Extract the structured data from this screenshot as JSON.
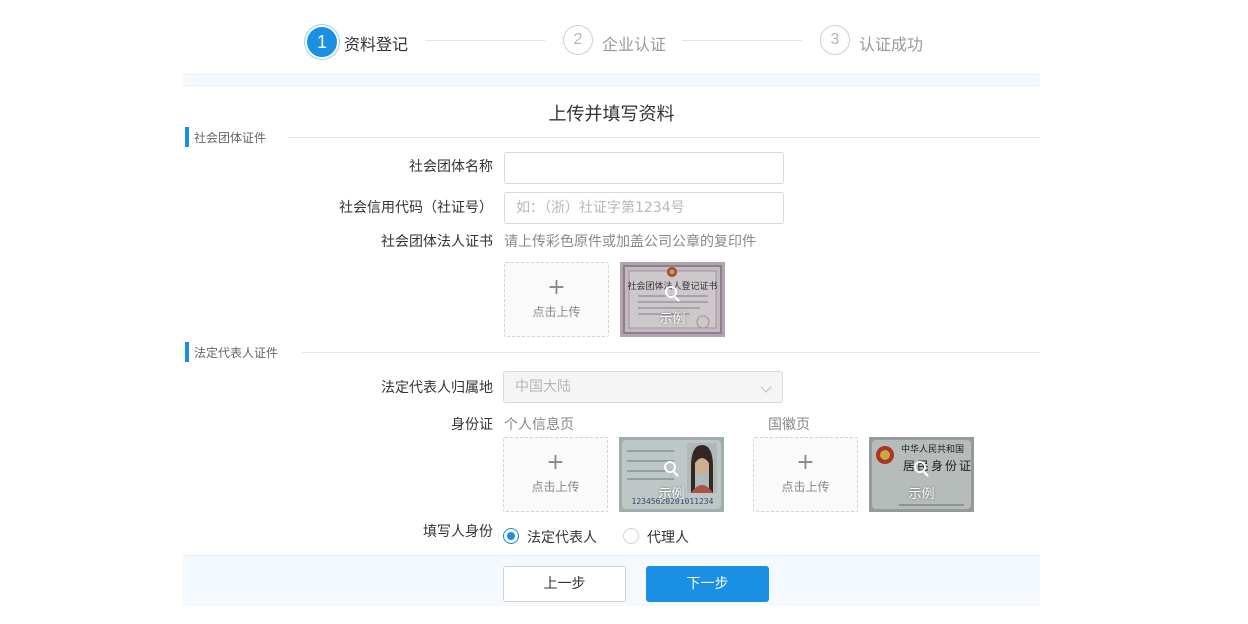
{
  "stepper": {
    "steps": [
      {
        "number": "1",
        "label": "资料登记",
        "active": true
      },
      {
        "number": "2",
        "label": "企业认证",
        "active": false
      },
      {
        "number": "3",
        "label": "认证成功",
        "active": false
      }
    ]
  },
  "form": {
    "title": "上传并填写资料",
    "section_org": {
      "heading": "社会团体证件",
      "org_name_label": "社会团体名称",
      "org_name_value": "",
      "credit_code_label": "社会信用代码（社证号）",
      "credit_code_placeholder": "如：（浙）社证字第1234号",
      "credit_code_value": "",
      "cert_label": "社会团体法人证书",
      "cert_hint": "请上传彩色原件或加盖公司公章的复印件",
      "upload_plus": "+",
      "upload_label": "点击上传",
      "sample_caption": "示例",
      "sample_title": "社会团体法人登记证书"
    },
    "section_legal": {
      "heading": "法定代表人证件",
      "region_label": "法定代表人归属地",
      "region_value": "中国大陆",
      "id_label": "身份证",
      "id_front_label": "个人信息页",
      "id_back_label": "国徽页",
      "upload_plus": "+",
      "upload_label": "点击上传",
      "sample_caption": "示例",
      "id_back_title_line1": "中华人民共和国",
      "id_back_title_line2": "居民身份证",
      "id_front_number": "12345620201011234",
      "role_label": "填写人身份",
      "role_options": [
        {
          "label": "法定代表人",
          "checked": true
        },
        {
          "label": "代理人",
          "checked": false
        }
      ]
    }
  },
  "footer": {
    "prev_label": "上一步",
    "next_label": "下一步"
  },
  "colors": {
    "accent": "#1a8fe3",
    "footer_bg": "#f4f9fd"
  }
}
